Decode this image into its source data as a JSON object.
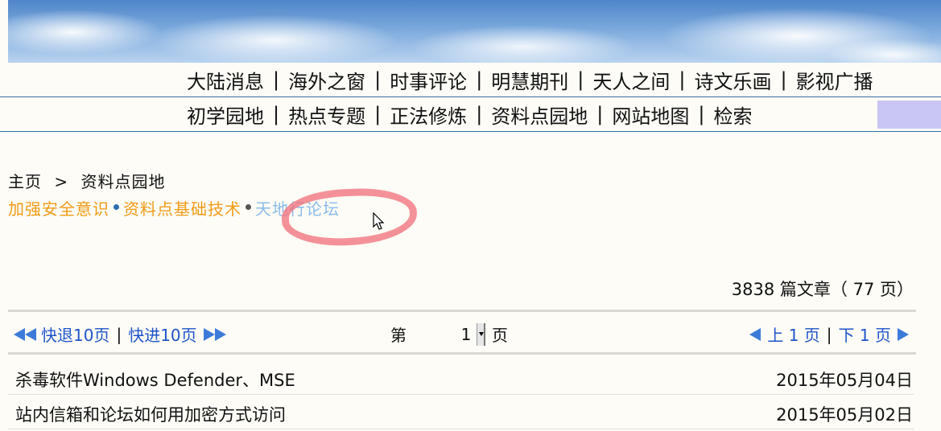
{
  "nav_row1": [
    "大陆消息",
    "海外之窗",
    "时事评论",
    "明慧期刊",
    "天人之间",
    "诗文乐画",
    "影视广播"
  ],
  "nav_row2": [
    "初学园地",
    "热点专题",
    "正法修炼",
    "资料点园地",
    "网站地图",
    "检索"
  ],
  "nav_separator": "|",
  "breadcrumb": {
    "home": "主页",
    "sep": ">",
    "current": "资料点园地"
  },
  "subnav": {
    "item1": "加强安全意识",
    "item2": "资料点基础技术",
    "item3": "天地行论坛"
  },
  "article_count": "3838 篇文章（ 77 页）",
  "pager": {
    "back10": "快退10页",
    "sep": "|",
    "fwd10": "快进10页",
    "page_prefix": "第",
    "page_value": "1",
    "page_suffix": "页",
    "prev": "上 1 页",
    "next": "下 1 页"
  },
  "articles": [
    {
      "title": "杀毒软件Windows Defender、MSE",
      "date": "2015年05月04日"
    },
    {
      "title": "站内信箱和论坛如何用加密方式访问",
      "date": "2015年05月02日"
    }
  ],
  "colors": {
    "orange_link": "#f19a17",
    "blue_link": "#1f54c9",
    "visited_link": "#8bbbe8",
    "annotation": "#f06e78"
  },
  "icons": [
    "double-left-arrow-icon",
    "double-right-arrow-icon",
    "left-arrow-icon",
    "right-arrow-icon",
    "mouse-cursor-icon"
  ]
}
